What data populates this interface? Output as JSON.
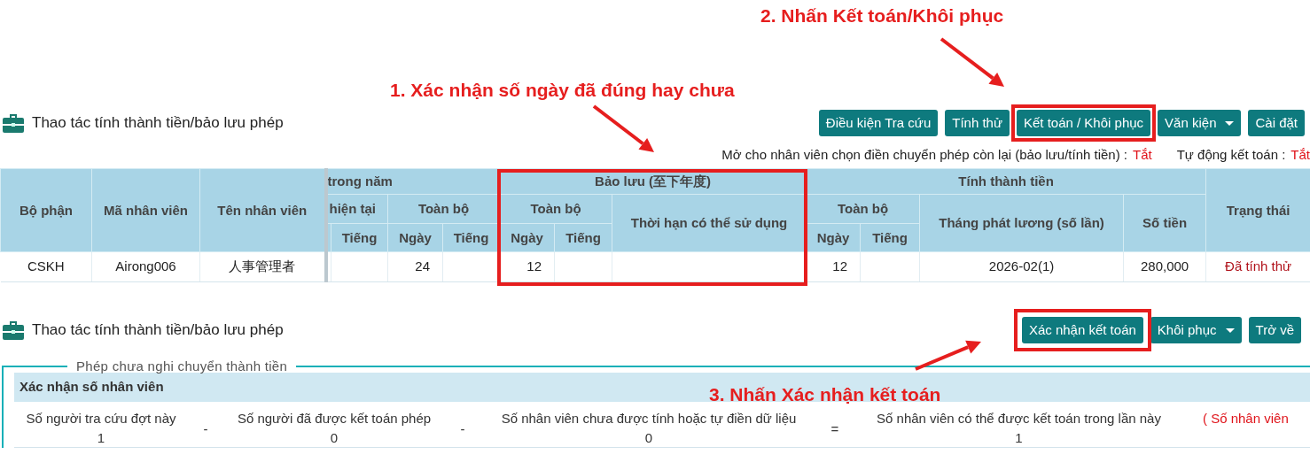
{
  "callouts": [
    "2. Nhấn Kết toán/Khôi phục",
    "1. Xác nhận số ngày đã đúng hay chưa",
    "3. Nhấn Xác nhận kết toán"
  ],
  "section1": {
    "title": "Thao tác tính thành tiền/bảo lưu phép",
    "buttons": [
      {
        "label": "Điều kiện Tra cứu",
        "dropdown": false
      },
      {
        "label": "Tính thử",
        "dropdown": false
      },
      {
        "label": "Kết toán / Khôi phục",
        "dropdown": false
      },
      {
        "label": "Văn kiện",
        "dropdown": true
      },
      {
        "label": "Cài đặt",
        "dropdown": false
      }
    ],
    "settings": [
      {
        "label": "Mở cho nhân viên chọn điền chuyển phép còn lại (bảo lưu/tính tiền) :",
        "value": "Tắt"
      },
      {
        "label": "Tự động kết toán :",
        "value": "Tắt"
      }
    ]
  },
  "table": {
    "header_rows": [
      [
        {
          "text": "Bộ phận",
          "rowspan": 3
        },
        {
          "text": "Mã nhân viên",
          "rowspan": 3
        },
        {
          "text": "Tên nhân viên",
          "rowspan": 3
        },
        {
          "text": "trong năm",
          "colspan": 4
        },
        {
          "text": "Bảo lưu (至下年度)",
          "colspan": 3
        },
        {
          "text": "Tính thành tiền",
          "colspan": 4
        },
        {
          "text": "Trạng thái",
          "rowspan": 3
        }
      ],
      [
        {
          "text": "hiện tại",
          "colspan": 2
        },
        {
          "text": "Toàn bộ",
          "colspan": 2
        },
        {
          "text": "Toàn bộ",
          "colspan": 2
        },
        {
          "text": "Thời hạn có thể sử dụng",
          "rowspan": 2
        },
        {
          "text": "Toàn bộ",
          "colspan": 2
        },
        {
          "text": "Tháng phát lương (số lần)",
          "rowspan": 2
        },
        {
          "text": "Số tiền",
          "rowspan": 2
        }
      ],
      [
        {},
        {
          "text": "Tiếng"
        },
        {
          "text": "Ngày"
        },
        {
          "text": "Tiếng"
        },
        {
          "text": "Ngày"
        },
        {
          "text": "Tiếng"
        },
        {
          "text": "Ngày"
        },
        {
          "text": "Tiếng"
        }
      ]
    ],
    "rows": [
      {
        "cells": [
          "CSKH",
          "Airong006",
          "人事管理者",
          "",
          "",
          "24",
          "",
          "12",
          "",
          "",
          "12",
          "",
          "2026-02(1)",
          "280,000"
        ],
        "status": "Đã tính thử"
      }
    ]
  },
  "section2": {
    "title": "Thao tác tính thành tiền/bảo lưu phép",
    "buttons": [
      {
        "label": "Xác nhận kết toán",
        "dropdown": false
      },
      {
        "label": "Khôi phục",
        "dropdown": true
      },
      {
        "label": "Trở về",
        "dropdown": false
      }
    ],
    "legend": "Phép chưa nghi chuyển thành tiền",
    "summary_title": "Xác nhận số nhân viên",
    "summary": [
      {
        "kind": "stat",
        "label": "Số người tra cứu đợt này",
        "value": "1"
      },
      {
        "kind": "operator",
        "label": "-"
      },
      {
        "kind": "stat",
        "label": "Số người đã được kết toán phép",
        "value": "0"
      },
      {
        "kind": "operator",
        "label": "-"
      },
      {
        "kind": "stat",
        "label": "Số nhân viên chưa được tính hoặc tự điền dữ liệu",
        "value": "0"
      },
      {
        "kind": "operator",
        "label": "="
      },
      {
        "kind": "stat",
        "label": "Số nhân viên có thể được kết toán trong lần này",
        "value": "1"
      },
      {
        "kind": "note",
        "label": "( Số nhân viên"
      }
    ]
  }
}
